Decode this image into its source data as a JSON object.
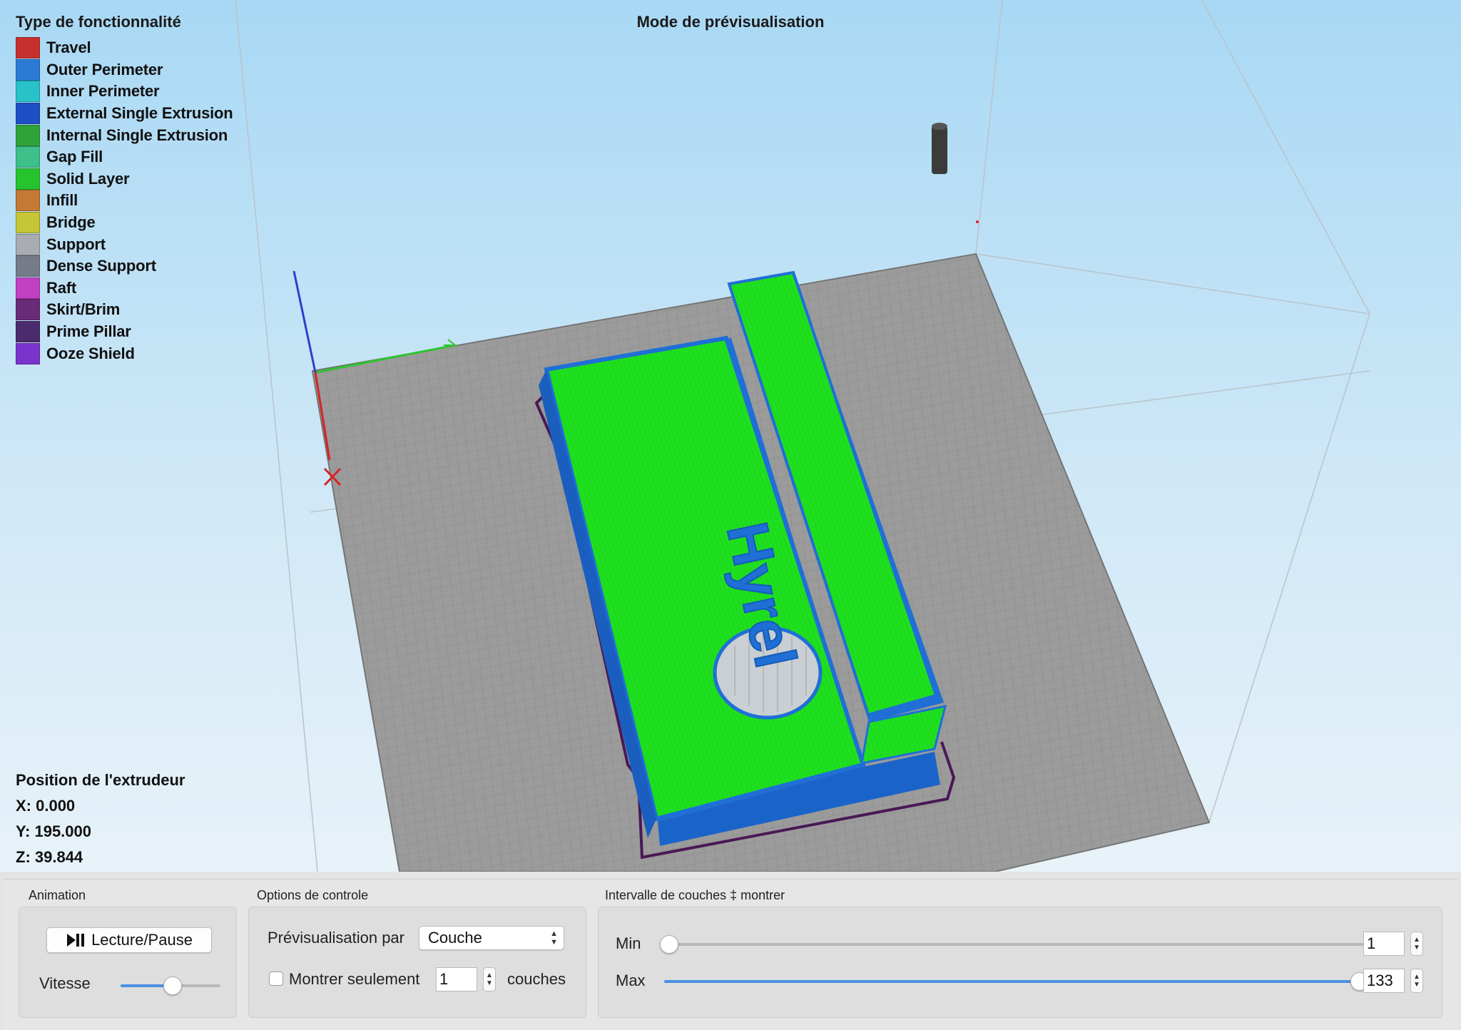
{
  "viewport": {
    "title": "Mode de prévisualisation",
    "legend": {
      "title": "Type de fonctionnalité",
      "items": [
        {
          "label": "Travel",
          "color": "#c8302e"
        },
        {
          "label": "Outer Perimeter",
          "color": "#2b7bd6"
        },
        {
          "label": "Inner Perimeter",
          "color": "#27c3c9"
        },
        {
          "label": "External Single Extrusion",
          "color": "#1f4fc4"
        },
        {
          "label": "Internal Single Extrusion",
          "color": "#2fa33a"
        },
        {
          "label": "Gap Fill",
          "color": "#3dc08a"
        },
        {
          "label": "Solid Layer",
          "color": "#25c42f"
        },
        {
          "label": "Infill",
          "color": "#c47a35"
        },
        {
          "label": "Bridge",
          "color": "#c6c536"
        },
        {
          "label": "Support",
          "color": "#a9acb0"
        },
        {
          "label": "Dense Support",
          "color": "#757c87"
        },
        {
          "label": "Raft",
          "color": "#c23fc2"
        },
        {
          "label": "Skirt/Brim",
          "color": "#6a2b78"
        },
        {
          "label": "Prime Pillar",
          "color": "#4b2a6d"
        },
        {
          "label": "Ooze Shield",
          "color": "#7a33cc"
        }
      ]
    },
    "model_text": "Hyrel",
    "extruder": {
      "title": "Position de l'extrudeur",
      "x": "X: 0.000",
      "y": "Y: 195.000",
      "z": "Z: 39.844"
    }
  },
  "panel": {
    "animation": {
      "label": "Animation",
      "play_pause": "Lecture/Pause",
      "speed_label": "Vitesse",
      "speed_level": 0.52
    },
    "controls": {
      "label": "Options de controle",
      "preview_by_label": "Prévisualisation par",
      "preview_by_value": "Couche",
      "show_only_label": "Montrer seulement",
      "show_only_value": "1",
      "layers_suffix": "couches",
      "show_only_checked": false
    },
    "range": {
      "label": "Intervalle de couches ‡ montrer",
      "min_label": "Min",
      "min_value": "1",
      "max_label": "Max",
      "max_value": "133"
    }
  }
}
